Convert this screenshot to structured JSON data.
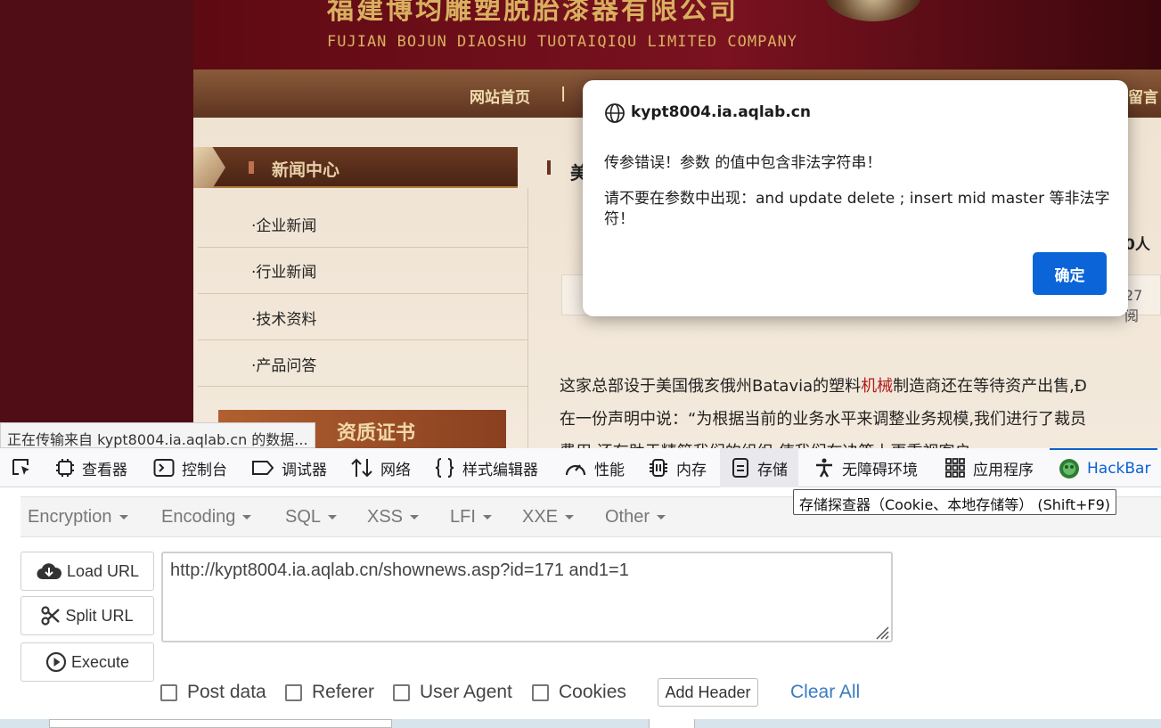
{
  "site": {
    "company_name_cn": "福建博均雕塑脱胎漆器有限公司",
    "company_name_en": "FUJIAN BOJUN DIAOSHU  TUOTAIQIQU  LIMITED COMPANY",
    "nav": [
      "网站首页",
      "|",
      "留言"
    ],
    "sidebar": {
      "title": "新闻中心",
      "links": [
        "·企业新闻",
        "·行业新闻",
        "·技术资料",
        "·产品问答"
      ],
      "qualification_banner": "资质证书"
    },
    "article": {
      "heading_fragment": "美",
      "right_fragment_1": "0人",
      "right_fragment_2": "27 阅",
      "line1_prefix": "这家总部设于美国俄亥俄州Batavia的塑料",
      "line1_keyword": "机械",
      "line1_suffix": "制造商还在等待资产出售,Ð",
      "line2": "在一份声明中说：“为根据当前的业务水平来调整业务规模,我们进行了裁员",
      "line3": "费用,还有助于精简我们的组织,使我们在决策上更重视客户"
    },
    "status_tooltip": "正在传输来自 kypt8004.ia.aqlab.cn 的数据..."
  },
  "dialog": {
    "origin": "kypt8004.ia.aqlab.cn",
    "message_line1": "传参错误！参数  的值中包含非法字符串！",
    "message_line2": "请不要在参数中出现：and update delete ; insert mid master 等非法字符！",
    "ok_label": "确定"
  },
  "devtools": {
    "tabs": [
      "查看器",
      "控制台",
      "调试器",
      "网络",
      "样式编辑器",
      "性能",
      "内存",
      "存储",
      "无障碍环境",
      "应用程序",
      "HackBar"
    ],
    "active_tab": "HackBar",
    "tooltip": "存储探查器（Cookie、本地存储等） (Shift+F9)"
  },
  "hackbar": {
    "menu": [
      "Encryption",
      "Encoding",
      "SQL",
      "XSS",
      "LFI",
      "XXE",
      "Other"
    ],
    "load_url": "Load URL",
    "split_url": "Split URL",
    "execute": "Execute",
    "url_value": "http://kypt8004.ia.aqlab.cn/shownews.asp?id=171 and1=1",
    "checkboxes": [
      "Post data",
      "Referer",
      "User Agent",
      "Cookies"
    ],
    "add_header": "Add Header",
    "clear_all": "Clear All"
  },
  "colors": {
    "accent_blue": "#0b64d8",
    "hackbar_blue": "#0a62d0",
    "banner_gold": "#d8b060",
    "site_maroon": "#4a0c14"
  },
  "icons": [
    "globe-icon",
    "picker-icon",
    "inspector-icon",
    "console-icon",
    "debugger-icon",
    "network-icon",
    "style-editor-icon",
    "performance-icon",
    "memory-icon",
    "storage-icon",
    "accessibility-icon",
    "application-icon",
    "hackbar-icon",
    "cloud-download-icon",
    "scissors-icon",
    "play-circle-icon",
    "resize-handle-icon"
  ]
}
